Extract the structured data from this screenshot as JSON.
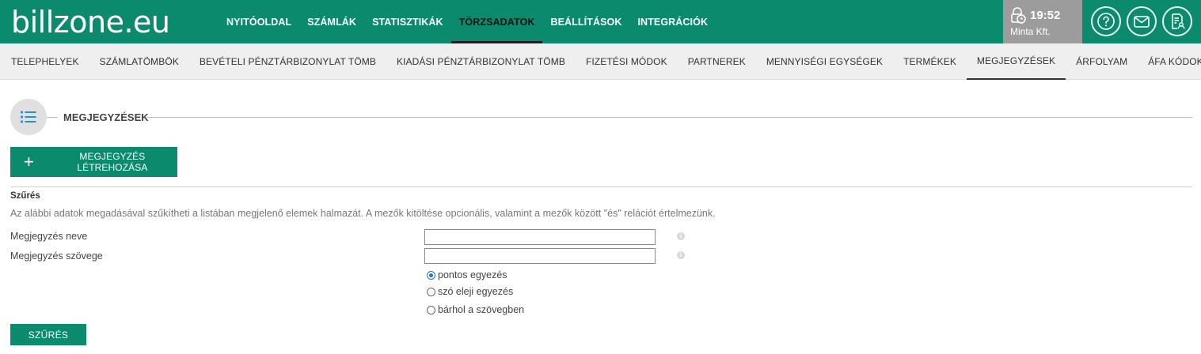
{
  "app": {
    "logo_text": "billzone.eu"
  },
  "main_nav": [
    {
      "label": "NYITÓOLDAL",
      "active": false
    },
    {
      "label": "SZÁMLÁK",
      "active": false
    },
    {
      "label": "STATISZTIKÁK",
      "active": false
    },
    {
      "label": "TÖRZSADATOK",
      "active": true
    },
    {
      "label": "BEÁLLÍTÁSOK",
      "active": false
    },
    {
      "label": "INTEGRÁCIÓK",
      "active": false
    }
  ],
  "session": {
    "time": "19:52",
    "company": "Minta Kft."
  },
  "header_icons": [
    "help-icon",
    "mail-icon",
    "document-user-icon"
  ],
  "sub_nav": [
    {
      "label": "TELEPHELYEK",
      "active": false
    },
    {
      "label": "SZÁMLATÖMBÖK",
      "active": false
    },
    {
      "label": "BEVÉTELI PÉNZTÁRBIZONYLAT TÖMB",
      "active": false
    },
    {
      "label": "KIADÁSI PÉNZTÁRBIZONYLAT TÖMB",
      "active": false
    },
    {
      "label": "FIZETÉSI MÓDOK",
      "active": false
    },
    {
      "label": "PARTNEREK",
      "active": false
    },
    {
      "label": "MENNYISÉGI EGYSÉGEK",
      "active": false
    },
    {
      "label": "TERMÉKEK",
      "active": false
    },
    {
      "label": "MEGJEGYZÉSEK",
      "active": true
    },
    {
      "label": "ÁRFOLYAM",
      "active": false
    },
    {
      "label": "ÁFA KÓDOK",
      "active": false
    }
  ],
  "section": {
    "title": "MEGJEGYZÉSEK",
    "icon": "list-icon"
  },
  "create_button": {
    "label": "MEGJEGYZÉS LÉTREHOZÁSA"
  },
  "filter": {
    "title": "Szűrés",
    "description": "Az alábbi adatok megadásával szűkítheti a listában megjelenő elemek halmazát. A mezők kitöltése opcionális, valamint a mezők között \"és\" relációt értelmezünk.",
    "fields": [
      {
        "label": "Megjegyzés neve",
        "value": "",
        "placeholder": ""
      },
      {
        "label": "Megjegyzés szövege",
        "value": "",
        "placeholder": ""
      }
    ],
    "match_options": [
      {
        "label": "pontos egyezés",
        "checked": true
      },
      {
        "label": "szó eleji egyezés",
        "checked": false
      },
      {
        "label": "bárhol a szövegben",
        "checked": false
      }
    ],
    "submit_label": "SZŰRÉS"
  },
  "colors": {
    "brand_green": "#0b8a6d",
    "session_gray": "#9c9c9c",
    "radio_blue": "#1a73e8"
  }
}
